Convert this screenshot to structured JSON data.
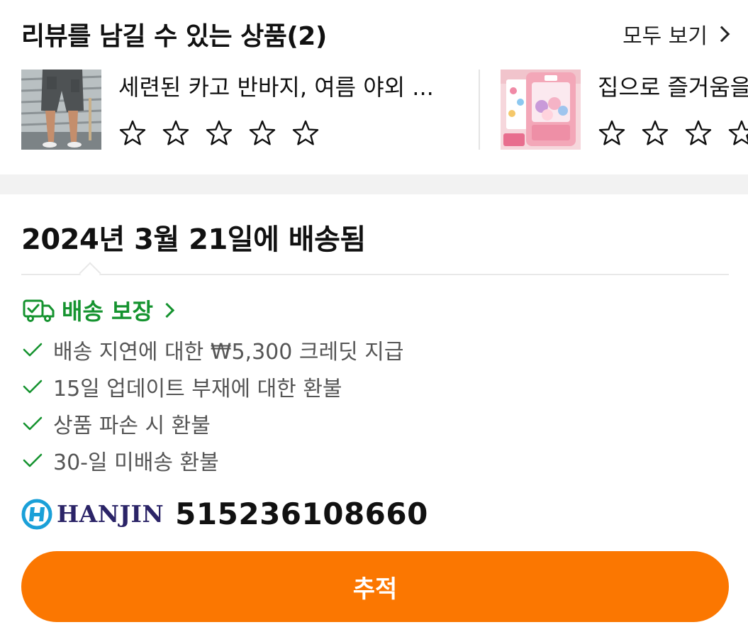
{
  "review": {
    "title": "리뷰를 남길 수 있는 상품(2)",
    "see_all_label": "모두 보기",
    "products": [
      {
        "name": "세련된 카고 반바지, 여름 야외 ...",
        "rating": 0,
        "max_rating": 5
      },
      {
        "name": "집으로 즐거움을",
        "rating": 0,
        "max_rating": 5
      }
    ]
  },
  "delivery": {
    "status_title": "2024년 3월 21일에 배송됨",
    "guarantee_label": "배송 보장",
    "guarantee_icon": "truck-icon",
    "benefits": [
      "배송 지연에 대한 ₩5,300 크레딧 지급",
      "15일 업데이트 부재에 대한 환불",
      "상품 파손 시 환불",
      "30-일 미배송 환불"
    ],
    "carrier_name": "HANJIN",
    "tracking_number": "515236108660",
    "track_button_label": "추적"
  },
  "colors": {
    "accent": "#fb7701",
    "guarantee_green": "#15932f",
    "carrier_blue": "#2b2467",
    "logo_cyan": "#1aa0d8"
  }
}
